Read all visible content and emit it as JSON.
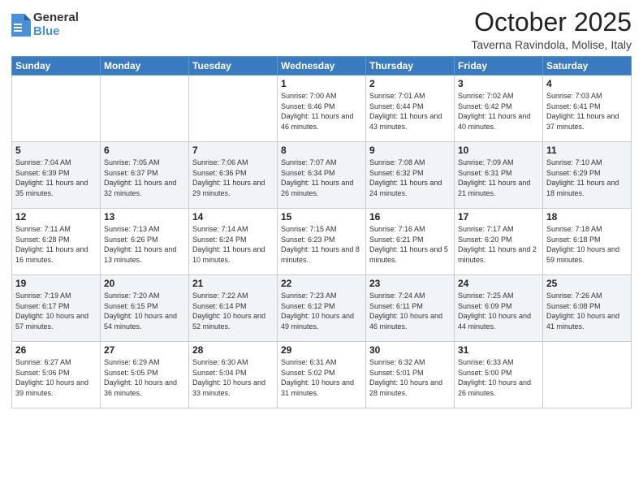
{
  "logo": {
    "general": "General",
    "blue": "Blue"
  },
  "title": "October 2025",
  "subtitle": "Taverna Ravindola, Molise, Italy",
  "days_of_week": [
    "Sunday",
    "Monday",
    "Tuesday",
    "Wednesday",
    "Thursday",
    "Friday",
    "Saturday"
  ],
  "weeks": [
    [
      {
        "day": "",
        "sunrise": "",
        "sunset": "",
        "daylight": ""
      },
      {
        "day": "",
        "sunrise": "",
        "sunset": "",
        "daylight": ""
      },
      {
        "day": "",
        "sunrise": "",
        "sunset": "",
        "daylight": ""
      },
      {
        "day": "1",
        "sunrise": "Sunrise: 7:00 AM",
        "sunset": "Sunset: 6:46 PM",
        "daylight": "Daylight: 11 hours and 46 minutes."
      },
      {
        "day": "2",
        "sunrise": "Sunrise: 7:01 AM",
        "sunset": "Sunset: 6:44 PM",
        "daylight": "Daylight: 11 hours and 43 minutes."
      },
      {
        "day": "3",
        "sunrise": "Sunrise: 7:02 AM",
        "sunset": "Sunset: 6:42 PM",
        "daylight": "Daylight: 11 hours and 40 minutes."
      },
      {
        "day": "4",
        "sunrise": "Sunrise: 7:03 AM",
        "sunset": "Sunset: 6:41 PM",
        "daylight": "Daylight: 11 hours and 37 minutes."
      }
    ],
    [
      {
        "day": "5",
        "sunrise": "Sunrise: 7:04 AM",
        "sunset": "Sunset: 6:39 PM",
        "daylight": "Daylight: 11 hours and 35 minutes."
      },
      {
        "day": "6",
        "sunrise": "Sunrise: 7:05 AM",
        "sunset": "Sunset: 6:37 PM",
        "daylight": "Daylight: 11 hours and 32 minutes."
      },
      {
        "day": "7",
        "sunrise": "Sunrise: 7:06 AM",
        "sunset": "Sunset: 6:36 PM",
        "daylight": "Daylight: 11 hours and 29 minutes."
      },
      {
        "day": "8",
        "sunrise": "Sunrise: 7:07 AM",
        "sunset": "Sunset: 6:34 PM",
        "daylight": "Daylight: 11 hours and 26 minutes."
      },
      {
        "day": "9",
        "sunrise": "Sunrise: 7:08 AM",
        "sunset": "Sunset: 6:32 PM",
        "daylight": "Daylight: 11 hours and 24 minutes."
      },
      {
        "day": "10",
        "sunrise": "Sunrise: 7:09 AM",
        "sunset": "Sunset: 6:31 PM",
        "daylight": "Daylight: 11 hours and 21 minutes."
      },
      {
        "day": "11",
        "sunrise": "Sunrise: 7:10 AM",
        "sunset": "Sunset: 6:29 PM",
        "daylight": "Daylight: 11 hours and 18 minutes."
      }
    ],
    [
      {
        "day": "12",
        "sunrise": "Sunrise: 7:11 AM",
        "sunset": "Sunset: 6:28 PM",
        "daylight": "Daylight: 11 hours and 16 minutes."
      },
      {
        "day": "13",
        "sunrise": "Sunrise: 7:13 AM",
        "sunset": "Sunset: 6:26 PM",
        "daylight": "Daylight: 11 hours and 13 minutes."
      },
      {
        "day": "14",
        "sunrise": "Sunrise: 7:14 AM",
        "sunset": "Sunset: 6:24 PM",
        "daylight": "Daylight: 11 hours and 10 minutes."
      },
      {
        "day": "15",
        "sunrise": "Sunrise: 7:15 AM",
        "sunset": "Sunset: 6:23 PM",
        "daylight": "Daylight: 11 hours and 8 minutes."
      },
      {
        "day": "16",
        "sunrise": "Sunrise: 7:16 AM",
        "sunset": "Sunset: 6:21 PM",
        "daylight": "Daylight: 11 hours and 5 minutes."
      },
      {
        "day": "17",
        "sunrise": "Sunrise: 7:17 AM",
        "sunset": "Sunset: 6:20 PM",
        "daylight": "Daylight: 11 hours and 2 minutes."
      },
      {
        "day": "18",
        "sunrise": "Sunrise: 7:18 AM",
        "sunset": "Sunset: 6:18 PM",
        "daylight": "Daylight: 10 hours and 59 minutes."
      }
    ],
    [
      {
        "day": "19",
        "sunrise": "Sunrise: 7:19 AM",
        "sunset": "Sunset: 6:17 PM",
        "daylight": "Daylight: 10 hours and 57 minutes."
      },
      {
        "day": "20",
        "sunrise": "Sunrise: 7:20 AM",
        "sunset": "Sunset: 6:15 PM",
        "daylight": "Daylight: 10 hours and 54 minutes."
      },
      {
        "day": "21",
        "sunrise": "Sunrise: 7:22 AM",
        "sunset": "Sunset: 6:14 PM",
        "daylight": "Daylight: 10 hours and 52 minutes."
      },
      {
        "day": "22",
        "sunrise": "Sunrise: 7:23 AM",
        "sunset": "Sunset: 6:12 PM",
        "daylight": "Daylight: 10 hours and 49 minutes."
      },
      {
        "day": "23",
        "sunrise": "Sunrise: 7:24 AM",
        "sunset": "Sunset: 6:11 PM",
        "daylight": "Daylight: 10 hours and 46 minutes."
      },
      {
        "day": "24",
        "sunrise": "Sunrise: 7:25 AM",
        "sunset": "Sunset: 6:09 PM",
        "daylight": "Daylight: 10 hours and 44 minutes."
      },
      {
        "day": "25",
        "sunrise": "Sunrise: 7:26 AM",
        "sunset": "Sunset: 6:08 PM",
        "daylight": "Daylight: 10 hours and 41 minutes."
      }
    ],
    [
      {
        "day": "26",
        "sunrise": "Sunrise: 6:27 AM",
        "sunset": "Sunset: 5:06 PM",
        "daylight": "Daylight: 10 hours and 39 minutes."
      },
      {
        "day": "27",
        "sunrise": "Sunrise: 6:29 AM",
        "sunset": "Sunset: 5:05 PM",
        "daylight": "Daylight: 10 hours and 36 minutes."
      },
      {
        "day": "28",
        "sunrise": "Sunrise: 6:30 AM",
        "sunset": "Sunset: 5:04 PM",
        "daylight": "Daylight: 10 hours and 33 minutes."
      },
      {
        "day": "29",
        "sunrise": "Sunrise: 6:31 AM",
        "sunset": "Sunset: 5:02 PM",
        "daylight": "Daylight: 10 hours and 31 minutes."
      },
      {
        "day": "30",
        "sunrise": "Sunrise: 6:32 AM",
        "sunset": "Sunset: 5:01 PM",
        "daylight": "Daylight: 10 hours and 28 minutes."
      },
      {
        "day": "31",
        "sunrise": "Sunrise: 6:33 AM",
        "sunset": "Sunset: 5:00 PM",
        "daylight": "Daylight: 10 hours and 26 minutes."
      },
      {
        "day": "",
        "sunrise": "",
        "sunset": "",
        "daylight": ""
      }
    ]
  ]
}
